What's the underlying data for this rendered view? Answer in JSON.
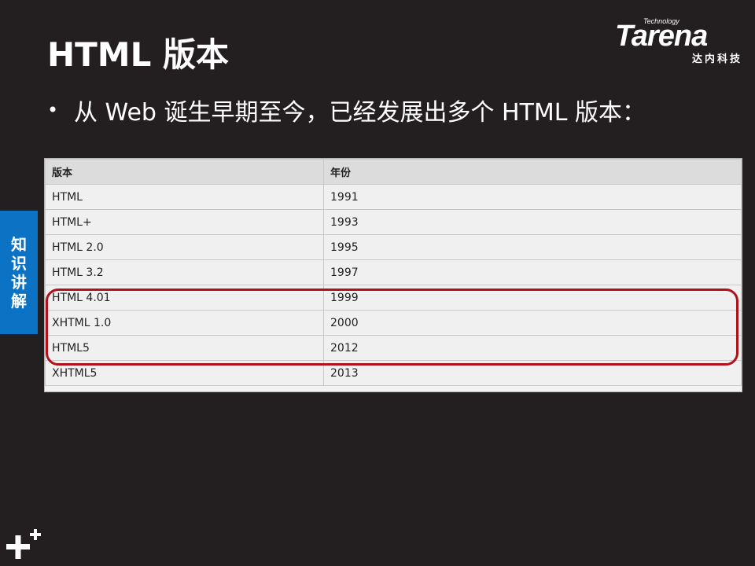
{
  "slide": {
    "title": "HTML 版本",
    "bullet": "从 Web 诞生早期至今，已经发展出多个 HTML 版本："
  },
  "logo": {
    "tech": "Technology",
    "word": "Tarena",
    "cn": "达内科技"
  },
  "side_tab": {
    "chars": [
      "知",
      "识",
      "讲",
      "解"
    ]
  },
  "table": {
    "headers": [
      "版本",
      "年份"
    ],
    "rows": [
      [
        "HTML",
        "1991"
      ],
      [
        "HTML+",
        "1993"
      ],
      [
        "HTML 2.0",
        "1995"
      ],
      [
        "HTML 3.2",
        "1997"
      ],
      [
        "HTML 4.01",
        "1999"
      ],
      [
        "XHTML 1.0",
        "2000"
      ],
      [
        "HTML5",
        "2012"
      ],
      [
        "XHTML5",
        "2013"
      ]
    ],
    "highlighted_rows": [
      "HTML 4.01",
      "XHTML 1.0",
      "HTML5"
    ]
  },
  "colors": {
    "background": "#231f20",
    "side_tab": "#0b72c4",
    "highlight": "#b0121b"
  }
}
